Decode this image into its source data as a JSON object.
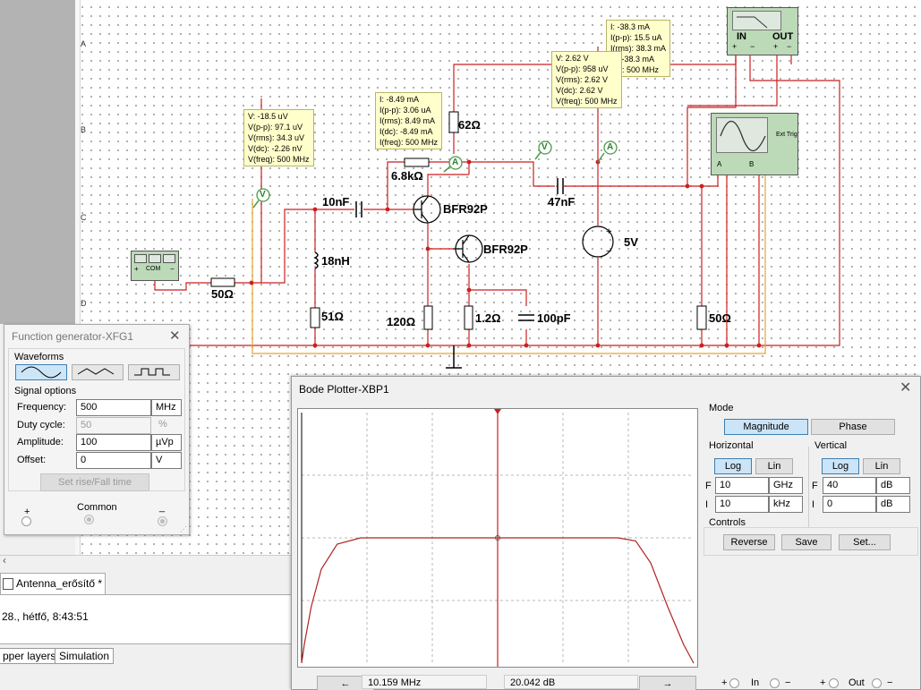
{
  "schematic": {
    "row_labels": [
      "A",
      "B",
      "C",
      "D"
    ],
    "components": {
      "r_62": "62Ω",
      "r_6k8": "6.8kΩ",
      "c_10nF": "10nF",
      "ind_18nH": "18nH",
      "r_51": "51Ω",
      "r_50_left": "50Ω",
      "r_120": "120Ω",
      "r_1k2": "1.2Ω",
      "c_100pF": "100pF",
      "c_47nF": "47nF",
      "v_5V": "5V",
      "r_50_right": "50Ω",
      "q1": "BFR92P",
      "q2": "BFR92P"
    },
    "voltmeter_symbol": "V",
    "ammeter_symbol": "A",
    "probe_left": [
      "V: -18.5 uV",
      "V(p-p): 97.1 uV",
      "V(rms): 34.3 uV",
      "V(dc): -2.26 nV",
      "V(freq): 500 MHz"
    ],
    "probe_center": [
      "I: -8.49 mA",
      "I(p-p): 3.06 uA",
      "I(rms): 8.49 mA",
      "I(dc): -8.49 mA",
      "I(freq): 500 MHz"
    ],
    "probe_right": [
      "V: 2.62 V",
      "V(p-p): 958 uV",
      "V(rms): 2.62 V",
      "V(dc): 2.62 V",
      "V(freq): 500 MHz"
    ],
    "probe_top": [
      "I: -38.3 mA",
      "I(p-p): 15.5 uA",
      "I(rms): 38.3 mA",
      "I(dc): -38.3 mA",
      "I(freq): 500 MHz"
    ],
    "probe_top_visible": [
      "I: -38.3 mA",
      "I(p-p): 15.5 uA",
      "I(rms): 38.3 mA",
      "c): -38.3 mA",
      "eq): 500 MHz"
    ],
    "bode_icon": {
      "in": "IN",
      "out": "OUT",
      "pins": [
        "+",
        "−",
        "+",
        "−"
      ]
    },
    "scope_icon": {
      "ext_trig": "Ext Trig",
      "a": "A",
      "b": "B"
    },
    "fgen_icon": {
      "com": "COM",
      "pins": [
        "+",
        "−"
      ]
    }
  },
  "function_generator": {
    "title": "Function generator-XFG1",
    "waveforms_label": "Waveforms",
    "signal_options_label": "Signal options",
    "fields": [
      {
        "label": "Frequency:",
        "value": "500",
        "unit": "MHz",
        "disabled": false
      },
      {
        "label": "Duty cycle:",
        "value": "50",
        "unit": "%",
        "disabled": true
      },
      {
        "label": "Amplitude:",
        "value": "100",
        "unit": "µVp",
        "disabled": false
      },
      {
        "label": "Offset:",
        "value": "0",
        "unit": "V",
        "disabled": false
      }
    ],
    "set_rise_fall": "Set rise/Fall time",
    "terminals": {
      "plus": "+",
      "common": "Common",
      "minus": "_"
    }
  },
  "bottom": {
    "tab_name": "Antenna_erősítő *",
    "log_text": "28., hétfő, 8:43:51",
    "bottom_tabs": [
      "pper layers",
      "Simulation"
    ]
  },
  "bode": {
    "title": "Bode Plotter-XBP1",
    "mode_label": "Mode",
    "magnitude": "Magnitude",
    "phase": "Phase",
    "horizontal_label": "Horizontal",
    "vertical_label": "Vertical",
    "log": "Log",
    "lin": "Lin",
    "h_f_label": "F",
    "h_f_value": "10",
    "h_f_unit": "GHz",
    "h_i_label": "I",
    "h_i_value": "10",
    "h_i_unit": "kHz",
    "v_f_label": "F",
    "v_f_value": "40",
    "v_f_unit": "dB",
    "v_i_label": "I",
    "v_i_value": "0",
    "v_i_unit": "dB",
    "controls_label": "Controls",
    "reverse": "Reverse",
    "save": "Save",
    "set": "Set...",
    "readout_freq": "10.159 MHz",
    "readout_db": "20.042 dB",
    "arrow_left": "←",
    "arrow_right": "→",
    "in_label": "In",
    "out_label": "Out",
    "plus": "+",
    "minus": "−",
    "cursor_fraction": 0.5
  },
  "chart_data": {
    "type": "line",
    "title": "",
    "xlabel": "",
    "ylabel": "",
    "x_scale": "log",
    "xlim": [
      10000,
      10000000000
    ],
    "ylim": [
      0,
      40
    ],
    "grid": true,
    "series": [
      {
        "x": [
          10000,
          11000,
          14000,
          20000,
          35000,
          80000,
          150000,
          1000000,
          10000000,
          100000000,
          700000000,
          1300000000,
          2200000000,
          4000000000,
          7000000000,
          10000000000
        ],
        "y": [
          0,
          3,
          9,
          15,
          19,
          20,
          20,
          20,
          20,
          20,
          20,
          19.5,
          16,
          9,
          3,
          0
        ]
      }
    ]
  }
}
